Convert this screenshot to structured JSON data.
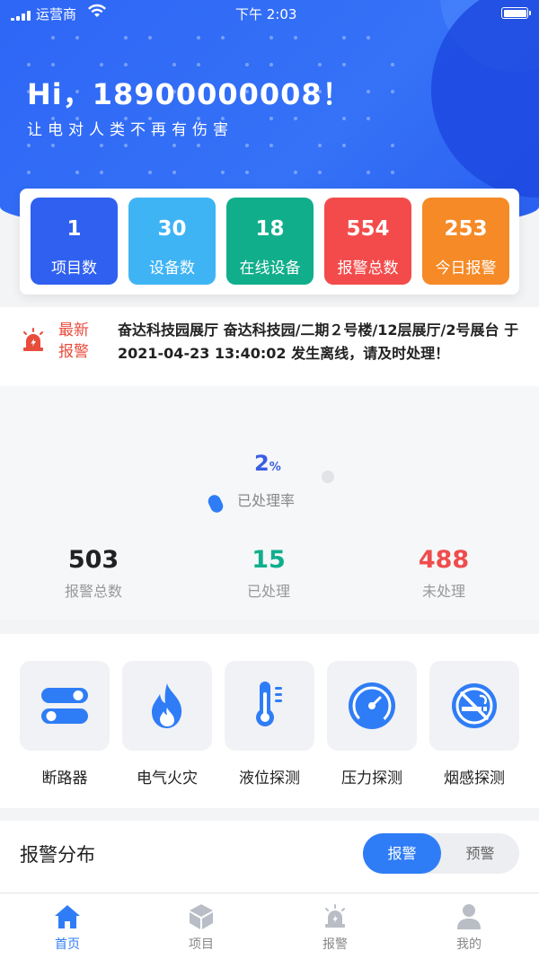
{
  "status_bar": {
    "carrier": "运营商",
    "time": "下午 2:03"
  },
  "header": {
    "greeting": "Hi，18900000008！",
    "slogan": "让电对人类不再有伤害"
  },
  "stats": [
    {
      "value": "1",
      "label": "项目数",
      "color": "#2f60f0"
    },
    {
      "value": "30",
      "label": "设备数",
      "color": "#3fb4f5"
    },
    {
      "value": "18",
      "label": "在线设备",
      "color": "#11ae8c"
    },
    {
      "value": "554",
      "label": "报警总数",
      "color": "#f34b4b"
    },
    {
      "value": "253",
      "label": "今日报警",
      "color": "#f58a27"
    }
  ],
  "latest_alert": {
    "tag": "最新报警",
    "text": "奋达科技园展厅 奋达科技园/二期２号楼/12层展厅/2号展台 于 2021-04-23 13:40:02 发生离线，请及时处理！"
  },
  "processing": {
    "rate_value": "2",
    "rate_unit": "%",
    "rate_label": "已处理率",
    "total_value": "503",
    "total_label": "报警总数",
    "handled_value": "15",
    "handled_label": "已处理",
    "unhandled_value": "488",
    "unhandled_label": "未处理"
  },
  "categories": [
    {
      "label": "断路器",
      "icon": "switch-toggle-icon"
    },
    {
      "label": "电气火灾",
      "icon": "fire-icon"
    },
    {
      "label": "液位探测",
      "icon": "thermometer-icon"
    },
    {
      "label": "压力探测",
      "icon": "gauge-icon"
    },
    {
      "label": "烟感探测",
      "icon": "no-smoking-icon"
    }
  ],
  "distribution": {
    "title": "报警分布",
    "tab_alarm": "报警",
    "tab_warning": "预警"
  },
  "tabbar": [
    {
      "label": "首页",
      "icon": "home-icon",
      "active": true
    },
    {
      "label": "项目",
      "icon": "cube-icon",
      "active": false
    },
    {
      "label": "报警",
      "icon": "alarm-siren-icon",
      "active": false
    },
    {
      "label": "我的",
      "icon": "user-icon",
      "active": false
    }
  ],
  "colors": {
    "primary": "#2f7df6",
    "alert_red": "#e84c3d",
    "handled_green": "#11ae8c"
  }
}
